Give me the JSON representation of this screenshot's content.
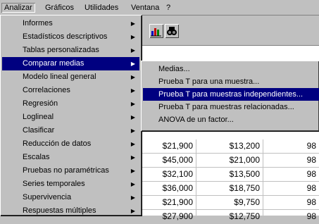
{
  "menubar": {
    "items": [
      {
        "label": "Analizar"
      },
      {
        "label": "Gráficos"
      },
      {
        "label": "Utilidades"
      },
      {
        "label": "Ventana"
      },
      {
        "label": "?"
      }
    ]
  },
  "analyze_menu": {
    "items": [
      {
        "label": "Informes"
      },
      {
        "label": "Estadísticos descriptivos"
      },
      {
        "label": "Tablas personalizadas"
      },
      {
        "label": "Comparar medias"
      },
      {
        "label": "Modelo lineal general"
      },
      {
        "label": "Correlaciones"
      },
      {
        "label": "Regresión"
      },
      {
        "label": "Loglineal"
      },
      {
        "label": "Clasificar"
      },
      {
        "label": "Reducción de datos"
      },
      {
        "label": "Escalas"
      },
      {
        "label": "Pruebas no paramétricas"
      },
      {
        "label": "Series temporales"
      },
      {
        "label": "Supervivencia"
      },
      {
        "label": "Respuestas múltiples"
      }
    ]
  },
  "compare_means_submenu": {
    "items": [
      {
        "label": "Medias..."
      },
      {
        "label": "Prueba T para una muestra..."
      },
      {
        "label": "Prueba T para muestras independientes..."
      },
      {
        "label": "Prueba T para muestras relacionadas..."
      },
      {
        "label": "ANOVA de un factor..."
      }
    ]
  },
  "data_rows": [
    {
      "col1": "$21,900",
      "col2": "$13,200",
      "col3": "98"
    },
    {
      "col1": "$45,000",
      "col2": "$21,000",
      "col3": "98"
    },
    {
      "col1": "$32,100",
      "col2": "$13,500",
      "col3": "98"
    },
    {
      "col1": "$36,000",
      "col2": "$18,750",
      "col3": "98"
    },
    {
      "col1": "$21,900",
      "col2": "$9,750",
      "col3": "98"
    },
    {
      "col1": "$27,900",
      "col2": "$12,750",
      "col3": "98"
    }
  ],
  "colors": {
    "highlight": "#000080",
    "face": "#c0c0c0"
  },
  "icons": [
    "chart-icon",
    "binoculars-icon",
    "submenu-arrow-icon"
  ]
}
